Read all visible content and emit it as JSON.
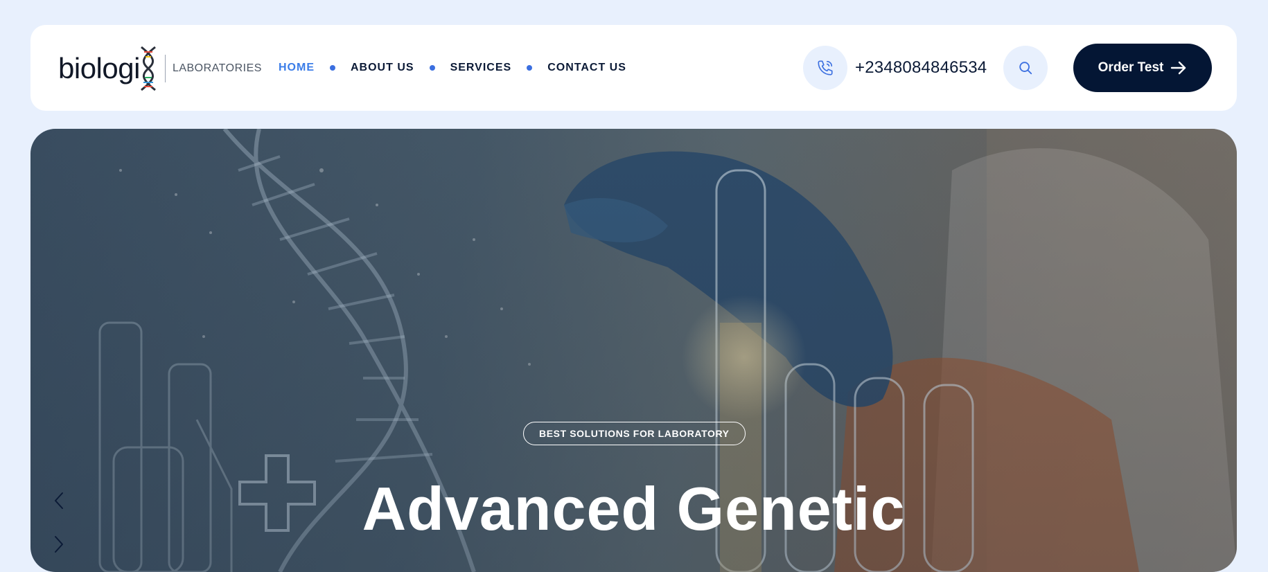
{
  "brand": {
    "name": "biologi",
    "subtitle": "LABORATORIES"
  },
  "nav": {
    "items": [
      {
        "label": "HOME",
        "active": true
      },
      {
        "label": "ABOUT US",
        "active": false
      },
      {
        "label": "SERVICES",
        "active": false
      },
      {
        "label": "CONTACT US",
        "active": false
      }
    ]
  },
  "contact": {
    "phone": "+2348084846534",
    "phone_icon": "phone-icon"
  },
  "search": {
    "icon": "search-icon"
  },
  "cta": {
    "label": "Order Test",
    "icon": "arrow-right-icon"
  },
  "hero": {
    "badge": "BEST SOLUTIONS FOR LABORATORY",
    "title": "Advanced Genetic",
    "prev_icon": "chevron-left-icon",
    "next_icon": "chevron-right-icon"
  },
  "colors": {
    "page_bg": "#e8f0fd",
    "accent": "#3b7de8",
    "navy": "#041634"
  }
}
